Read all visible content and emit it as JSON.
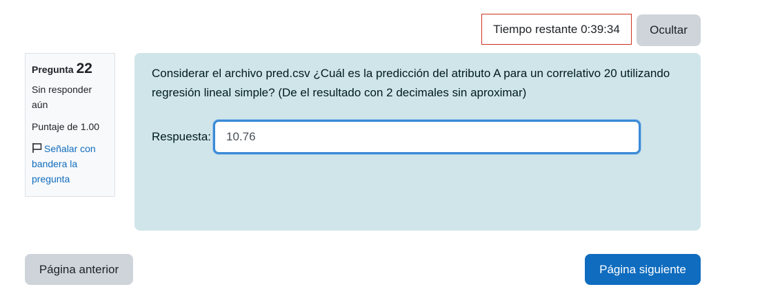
{
  "timer": {
    "label": "Tiempo restante 0:39:34",
    "hide_label": "Ocultar",
    "border_color": "#ca3120"
  },
  "question_info": {
    "prefix": "Pregunta",
    "number": "22",
    "state": "Sin responder aún",
    "grade": "Puntaje de 1.00",
    "flag_label": "Señalar con bandera la pregunta",
    "flag_icon": "flag-icon"
  },
  "question": {
    "text": "Considerar el archivo pred.csv ¿Cuál es la predicción del atributo A para un correlativo 20 utilizando regresión lineal simple? (De el resultado con 2 decimales sin aproximar)",
    "answer_label": "Respuesta:",
    "answer_value": "10.76",
    "background": "#cfe5e9"
  },
  "navigation": {
    "prev_label": "Página anterior",
    "next_label": "Página siguiente",
    "primary_color": "#0f6cbf"
  }
}
